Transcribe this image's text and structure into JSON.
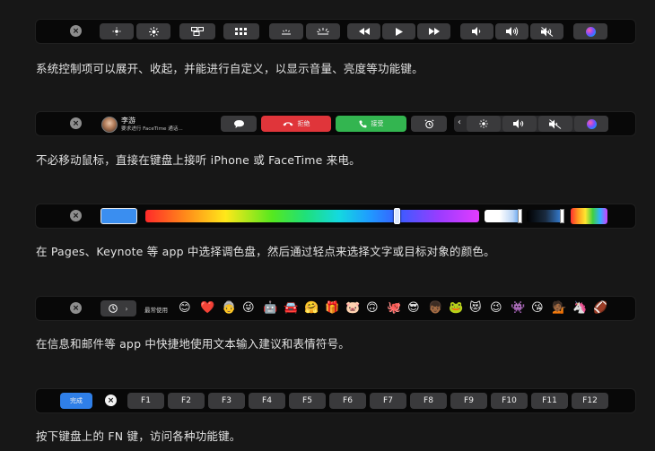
{
  "bar1": {
    "close": "×",
    "icons": [
      "brightness-down-icon",
      "brightness-up-icon",
      "mission-control-icon",
      "launchpad-icon",
      "keyboard-backlight-down-icon",
      "keyboard-backlight-up-icon",
      "rewind-icon",
      "play-icon",
      "fast-forward-icon",
      "volume-down-icon",
      "volume-up-icon",
      "mute-icon",
      "siri-icon"
    ]
  },
  "caption1": "系统控制项可以展开、收起，并能进行自定义，以显示音量、亮度等功能键。",
  "bar2": {
    "close": "×",
    "caller_name": "李游",
    "caller_sub": "要求进行 FaceTime 通话...",
    "decline_label": "拒绝",
    "accept_label": "接受"
  },
  "caption2": "不必移动鼠标，直接在键盘上接听 iPhone 或 FaceTime 来电。",
  "bar3": {
    "close": "×",
    "selected_color": "#3a8ef0"
  },
  "caption3": "在 Pages、Keynote 等 app 中选择调色盘，然后通过轻点来选择文字或目标对象的颜色。",
  "bar4": {
    "close": "×",
    "recent_label": "最常使用",
    "emojis": [
      "😊",
      "❤️",
      "👵",
      "😜",
      "🤖",
      "🚘",
      "🤗",
      "🎁",
      "🐷",
      "🙃",
      "🐙",
      "😎",
      "👦🏾",
      "🐸",
      "😻",
      "😉",
      "👾",
      "😘",
      "💁🏾",
      "🦄",
      "🏈"
    ]
  },
  "caption4": "在信息和邮件等 app 中快捷地使用文本输入建议和表情符号。",
  "bar5": {
    "done_label": "完成",
    "close": "×",
    "fkeys": [
      "F1",
      "F2",
      "F3",
      "F4",
      "F5",
      "F6",
      "F7",
      "F8",
      "F9",
      "F10",
      "F11",
      "F12"
    ]
  },
  "caption5": "按下键盘上的 FN 键，访问各种功能键。"
}
